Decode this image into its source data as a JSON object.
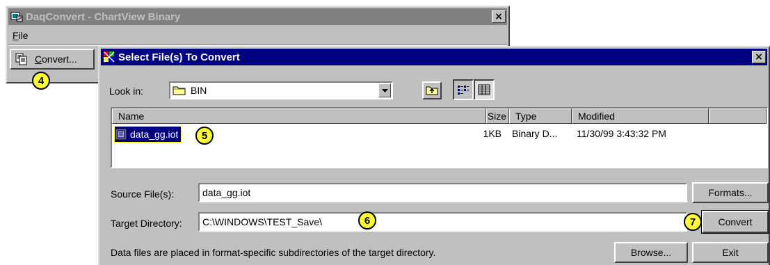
{
  "main_window": {
    "title": "DaqConvert - ChartView Binary",
    "close_glyph": "×",
    "menu": [
      {
        "label": "File",
        "accel": "F",
        "rest": "ile"
      }
    ],
    "convert_button": {
      "accel": "C",
      "rest": "onvert..."
    }
  },
  "dialog": {
    "title": "Select File(s) To Convert",
    "close_glyph": "×",
    "look_in_label": "Look in:",
    "look_in_value": "BIN",
    "list": {
      "columns": [
        "Name",
        "Size",
        "Type",
        "Modified"
      ],
      "rows": [
        {
          "name": "data_gg.iot",
          "size": "1KB",
          "type": "Binary D...",
          "modified": "11/30/99 3:43:32 PM",
          "selected": true
        }
      ]
    },
    "source_label": "Source File(s):",
    "source_value": "data_gg.iot",
    "target_label": "Target Directory:",
    "target_value": "C:\\WINDOWS\\TEST_Save\\",
    "info_text": "Data files are placed in format-specific subdirectories of the target directory.",
    "buttons": {
      "formats": "Formats...",
      "convert": "Convert",
      "browse": "Browse...",
      "exit": "Exit"
    }
  },
  "callouts": {
    "c4": "4",
    "c5": "5",
    "c6": "6",
    "c7": "7"
  },
  "colors": {
    "active_title": "#000080",
    "inactive_title": "#808080",
    "callout_fill": "#ffff33",
    "selection": "#000080"
  },
  "icons": {
    "app": "daqconvert-app-icon",
    "dialog": "dialog-app-icon",
    "convert": "copy-pages-icon",
    "folder": "folder-icon",
    "up_folder": "up-one-level-icon",
    "list_view": "list-view-icon",
    "details_view": "details-view-icon",
    "file": "binary-file-icon",
    "dropdown": "dropdown-arrow-icon"
  }
}
